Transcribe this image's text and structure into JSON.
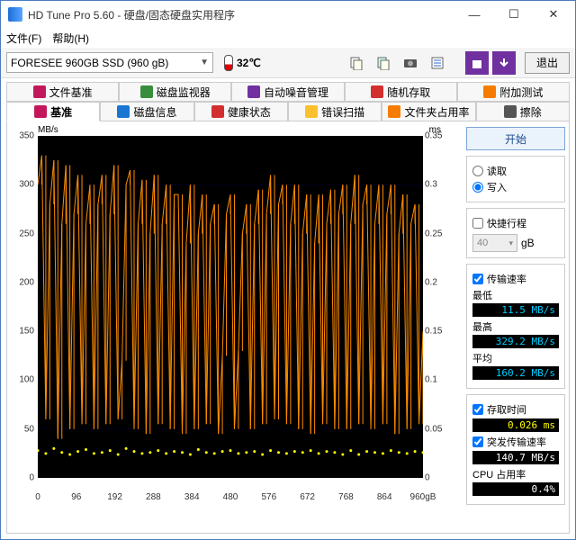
{
  "window": {
    "title": "HD Tune Pro 5.60 - 硬盘/固态硬盘实用程序"
  },
  "menu": {
    "file": "文件(F)",
    "help": "帮助(H)"
  },
  "toolbar": {
    "drive": "FORESEE 960GB SSD (960 gB)",
    "temp": "32℃",
    "exit": "退出",
    "icons": [
      "copy-icon",
      "copy2-icon",
      "camera-icon",
      "settings-icon",
      "save-icon",
      "down-icon"
    ]
  },
  "tabs_row1": [
    {
      "label": "文件基准",
      "icon": "file-bench-icon"
    },
    {
      "label": "磁盘监视器",
      "icon": "monitor-icon"
    },
    {
      "label": "自动噪音管理",
      "icon": "noise-icon"
    },
    {
      "label": "随机存取",
      "icon": "random-icon"
    },
    {
      "label": "附加测试",
      "icon": "extra-icon"
    }
  ],
  "tabs_row2": [
    {
      "label": "基准",
      "icon": "bench-icon",
      "active": true
    },
    {
      "label": "磁盘信息",
      "icon": "info-icon"
    },
    {
      "label": "健康状态",
      "icon": "health-icon"
    },
    {
      "label": "错误扫描",
      "icon": "error-icon"
    },
    {
      "label": "文件夹占用率",
      "icon": "folder-icon"
    },
    {
      "label": "擦除",
      "icon": "erase-icon"
    }
  ],
  "sidebar": {
    "start": "开始",
    "read": "读取",
    "write": "写入",
    "write_selected": true,
    "quick": "快捷行程",
    "block_size": "40",
    "block_unit": "gB",
    "rate_label": "传输速率",
    "min_label": "最低",
    "min_val": "11.5 MB/s",
    "max_label": "最高",
    "max_val": "329.2 MB/s",
    "avg_label": "平均",
    "avg_val": "160.2 MB/s",
    "access_label": "存取时间",
    "access_val": "0.026 ms",
    "burst_label": "突发传输速率",
    "burst_val": "140.7 MB/s",
    "cpu_label": "CPU 占用率",
    "cpu_val": "0.4%"
  },
  "chart_data": {
    "type": "line",
    "title": "",
    "xlabel": "gB",
    "ylabel": "MB/s",
    "y2label": "ms",
    "xlim": [
      0,
      960
    ],
    "ylim": [
      0,
      350
    ],
    "y2lim": [
      0,
      0.35
    ],
    "x_ticks": [
      0,
      96,
      192,
      288,
      384,
      480,
      576,
      672,
      768,
      864,
      "960gB"
    ],
    "y_ticks": [
      0,
      50,
      100,
      150,
      200,
      250,
      300,
      350
    ],
    "y2_ticks": [
      0,
      0.05,
      0.1,
      0.15,
      0.2,
      0.25,
      0.3,
      0.35
    ],
    "series": [
      {
        "name": "传输速率",
        "axis": "y",
        "color": "#ff8c00",
        "x": [
          0,
          10,
          20,
          30,
          40,
          50,
          60,
          70,
          80,
          90,
          100,
          110,
          120,
          130,
          140,
          150,
          160,
          170,
          180,
          190,
          200,
          210,
          220,
          230,
          240,
          250,
          260,
          270,
          280,
          290,
          300,
          310,
          320,
          330,
          340,
          350,
          360,
          370,
          380,
          390,
          400,
          410,
          420,
          430,
          440,
          450,
          460,
          470,
          480,
          490,
          500,
          510,
          520,
          530,
          540,
          550,
          560,
          570,
          580,
          590,
          600,
          610,
          620,
          630,
          640,
          650,
          660,
          670,
          680,
          690,
          700,
          710,
          720,
          730,
          740,
          750,
          760,
          770,
          780,
          790,
          800,
          810,
          820,
          830,
          840,
          850,
          860,
          870,
          880,
          890,
          900,
          910,
          920,
          930,
          940,
          950,
          960
        ],
        "values": [
          300,
          330,
          60,
          280,
          325,
          40,
          260,
          320,
          50,
          270,
          310,
          55,
          260,
          300,
          50,
          280,
          310,
          55,
          270,
          320,
          60,
          120,
          300,
          315,
          50,
          260,
          305,
          45,
          250,
          310,
          55,
          260,
          300,
          50,
          290,
          290,
          45,
          240,
          300,
          50,
          250,
          290,
          55,
          260,
          280,
          45,
          125,
          270,
          290,
          50,
          130,
          250,
          280,
          50,
          260,
          295,
          55,
          270,
          310,
          60,
          280,
          300,
          55,
          260,
          300,
          50,
          250,
          290,
          45,
          240,
          290,
          55,
          260,
          295,
          50,
          270,
          300,
          50,
          260,
          310,
          55,
          280,
          300,
          50,
          260,
          300,
          55,
          270,
          300,
          45,
          250,
          290,
          50,
          260,
          280,
          55,
          150
        ]
      },
      {
        "name": "存取时间",
        "axis": "y2",
        "color": "#ffff00",
        "style": "scatter",
        "x": [
          0,
          20,
          40,
          60,
          80,
          100,
          120,
          140,
          160,
          180,
          200,
          220,
          240,
          260,
          280,
          300,
          320,
          340,
          360,
          380,
          400,
          420,
          440,
          460,
          480,
          500,
          520,
          540,
          560,
          580,
          600,
          620,
          640,
          660,
          680,
          700,
          720,
          740,
          760,
          780,
          800,
          820,
          840,
          860,
          880,
          900,
          920,
          940,
          960
        ],
        "values": [
          0.028,
          0.025,
          0.03,
          0.026,
          0.024,
          0.027,
          0.029,
          0.025,
          0.026,
          0.028,
          0.024,
          0.03,
          0.027,
          0.025,
          0.026,
          0.028,
          0.025,
          0.027,
          0.026,
          0.024,
          0.029,
          0.026,
          0.025,
          0.027,
          0.028,
          0.025,
          0.026,
          0.027,
          0.024,
          0.028,
          0.026,
          0.025,
          0.027,
          0.026,
          0.028,
          0.025,
          0.027,
          0.026,
          0.024,
          0.028,
          0.024,
          0.027,
          0.026,
          0.025,
          0.028,
          0.026,
          0.025,
          0.027,
          0.026
        ]
      }
    ]
  }
}
